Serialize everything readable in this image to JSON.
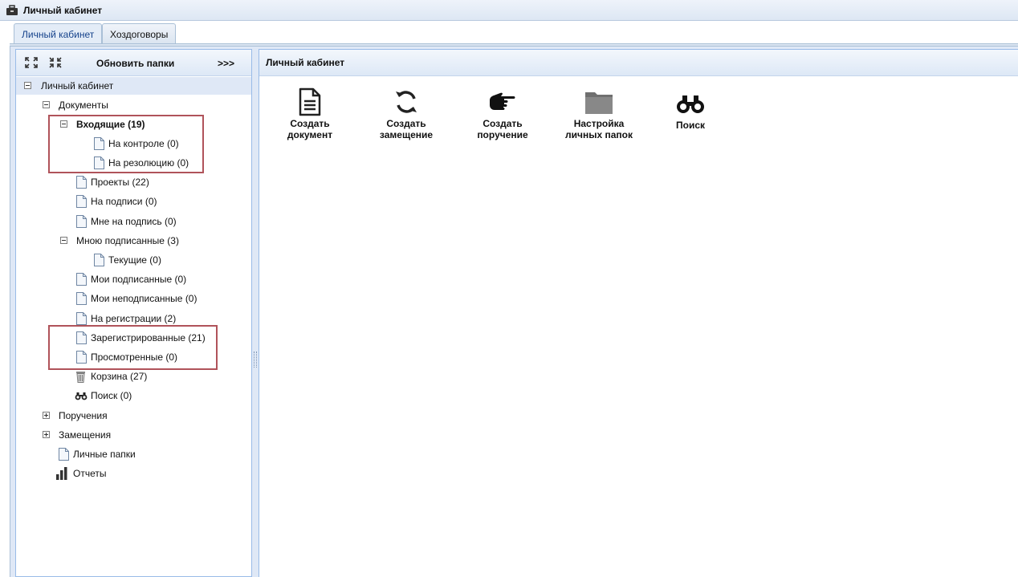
{
  "window": {
    "title": "Личный кабинет",
    "app_icon": "briefcase-icon"
  },
  "tabs": [
    {
      "label": "Личный кабинет",
      "active": true
    },
    {
      "label": "Хоздоговоры",
      "active": false
    }
  ],
  "left_toolbar": {
    "expand_icon": "expand-all-icon",
    "collapse_icon": "collapse-all-icon",
    "refresh_label": "Обновить папки",
    "more_label": ">>>"
  },
  "tree": {
    "root": "Личный кабинет",
    "documents": "Документы",
    "incoming": "Входящие (19)",
    "on_control": "На контроле (0)",
    "for_resolution": "На резолюцию (0)",
    "projects": "Проекты (22)",
    "on_signing": "На подписи (0)",
    "to_me_for_signature": "Мне на подпись (0)",
    "signed_by_me": "Мною подписанные (3)",
    "current": "Текущие (0)",
    "my_signed": "Мои подписанные (0)",
    "my_unsigned": "Мои неподписанные (0)",
    "on_registration": "На регистрации (2)",
    "registered": "Зарегистрированные (21)",
    "viewed": "Просмотренные (0)",
    "trash": "Корзина (27)",
    "search": "Поиск (0)",
    "assignments": "Поручения",
    "substitutions": "Замещения",
    "personal_folders": "Личные папки",
    "reports": "Отчеты"
  },
  "right_panel": {
    "title": "Личный кабинет",
    "actions": [
      {
        "label": "Создать\nдокумент",
        "icon": "document-icon"
      },
      {
        "label": "Создать\nзамещение",
        "icon": "refresh-icon"
      },
      {
        "label": "Создать\nпоручение",
        "icon": "pointing-hand-icon"
      },
      {
        "label": "Настройка\nличных папок",
        "icon": "folder-icon"
      },
      {
        "label": "Поиск",
        "icon": "binoculars-icon"
      }
    ]
  },
  "colors": {
    "highlight_box": "#b0535a",
    "panel_border": "#99bbe8",
    "header_bg": "#dde8f6"
  }
}
